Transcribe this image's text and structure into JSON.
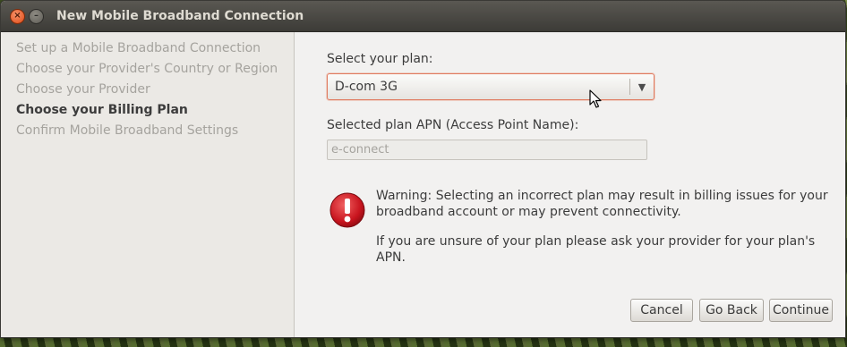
{
  "window": {
    "title": "New Mobile Broadband Connection"
  },
  "sidebar": {
    "steps": [
      {
        "label": "Set up a Mobile Broadband Connection"
      },
      {
        "label": "Choose your Provider's Country or Region"
      },
      {
        "label": "Choose your Provider"
      },
      {
        "label": "Choose your Billing Plan"
      },
      {
        "label": "Confirm Mobile Broadband Settings"
      }
    ],
    "active_step": "Choose your Billing Plan"
  },
  "plan": {
    "label": "Select your plan:",
    "selected": "D-com 3G"
  },
  "apn": {
    "label": "Selected plan APN (Access Point Name):",
    "value": "e-connect"
  },
  "warning": {
    "line1": "Warning: Selecting an incorrect plan may result in billing issues for your",
    "line2": "broadband account or may prevent connectivity.",
    "line3": "If you are unsure of your plan please ask your provider for your plan's APN."
  },
  "buttons": {
    "cancel": "Cancel",
    "back": "Go Back",
    "continue": "Continue"
  },
  "icons": {
    "close": "close-icon",
    "minimize": "minimize-icon",
    "warning": "warning-icon",
    "dropdown": "chevron-down-icon",
    "cursor": "mouse-cursor-icon"
  },
  "colors": {
    "focus_border": "#e07a5f",
    "warning_red": "#d6202b",
    "titlebar": "#3c3b37"
  }
}
